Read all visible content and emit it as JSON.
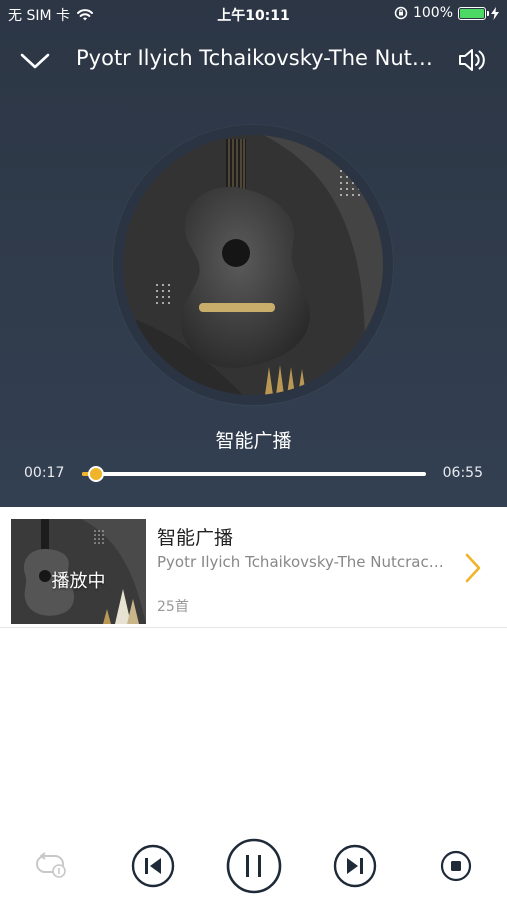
{
  "status_bar": {
    "carrier": "无 SIM 卡",
    "time": "上午10:11",
    "battery_percent": "100%",
    "battery_color": "#4cd964"
  },
  "nav": {
    "title": "Pyotr Ilyich Tchaikovsky-The Nutcracker",
    "back_icon": "chevron-down-icon",
    "volume_icon": "speaker-icon"
  },
  "player": {
    "album_title": "智能广播",
    "current_time": "00:17",
    "total_time": "06:55",
    "progress": 0.04,
    "accent_color": "#f0b429"
  },
  "now_playing": {
    "thumb_label": "播放中",
    "title": "智能广播",
    "subtitle": "Pyotr Ilyich Tchaikovsky-The Nutcracker",
    "count": "25首"
  },
  "controls": {
    "items": [
      "loop-mode-icon",
      "previous-icon",
      "pause-icon",
      "next-icon",
      "stop-icon"
    ]
  }
}
